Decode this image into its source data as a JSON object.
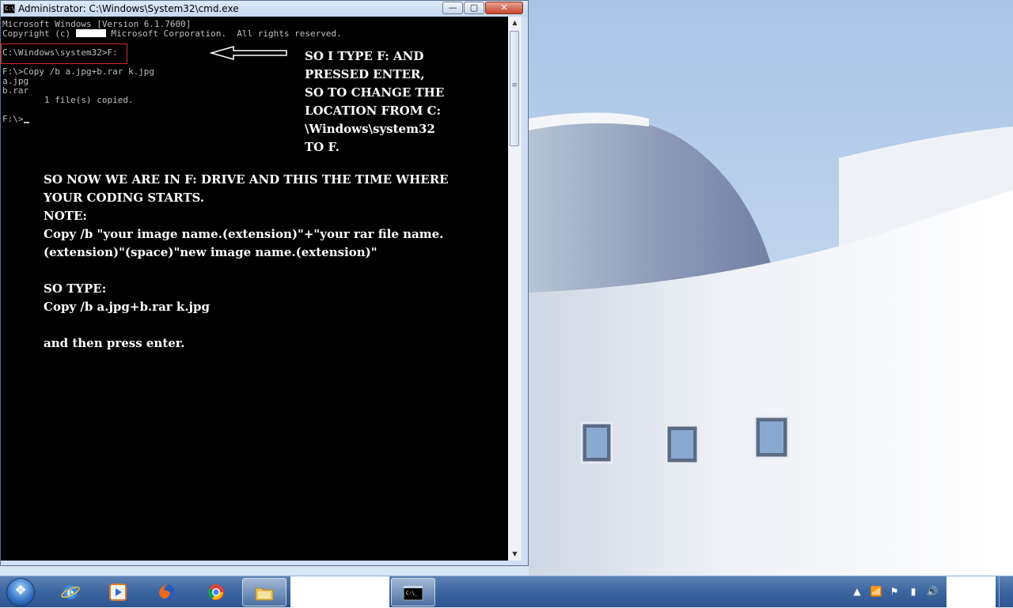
{
  "window": {
    "title": "Administrator: C:\\Windows\\System32\\cmd.exe",
    "icon_label": "C:\\",
    "minimize_glyph": "—",
    "maximize_glyph": "▢",
    "close_glyph": "✕"
  },
  "console": {
    "line1": "Microsoft Windows [Version 6.1.7600]",
    "line2_prefix": "Copyright (c) ",
    "line2_suffix": " Microsoft Corporation.  All rights reserved.",
    "line3_prompt": "C:\\Windows\\system32>",
    "line3_input": "F:",
    "line4": "F:\\>Copy /b a.jpg+b.rar k.jpg",
    "line5": "a.jpg",
    "line6": "b.rar",
    "line7": "        1 file(s) copied.",
    "line8_prompt": "F:\\>"
  },
  "notes": {
    "right": "SO I TYPE F: AND\nPRESSED ENTER,\nSO TO CHANGE THE\nLOCATION FROM C:\n\\Windows\\system32\nTO F.",
    "main": "SO NOW WE ARE IN F: DRIVE AND THIS THE TIME WHERE\nYOUR CODING STARTS.\nNOTE:\nCopy /b \"your image name.(extension)\"+\"your rar file name.\n(extension)\"(space)\"new image name.(extension)\"\n\nSO TYPE:\nCopy /b a.jpg+b.rar k.jpg\n\nand then press enter."
  },
  "taskbar": {
    "start_icon": "windows-logo",
    "pinned": [
      {
        "name": "internet-explorer"
      },
      {
        "name": "windows-media-player"
      },
      {
        "name": "firefox"
      },
      {
        "name": "chrome"
      },
      {
        "name": "windows-explorer"
      },
      {
        "name": "command-prompt"
      }
    ],
    "tray": [
      "show-hidden-icons",
      "network",
      "action-center",
      "power",
      "volume"
    ]
  },
  "colors": {
    "console_bg": "#000000",
    "console_fg": "#c0c0c0",
    "annotation_text": "#ffffff",
    "highlight_box": "#d42a2a"
  }
}
